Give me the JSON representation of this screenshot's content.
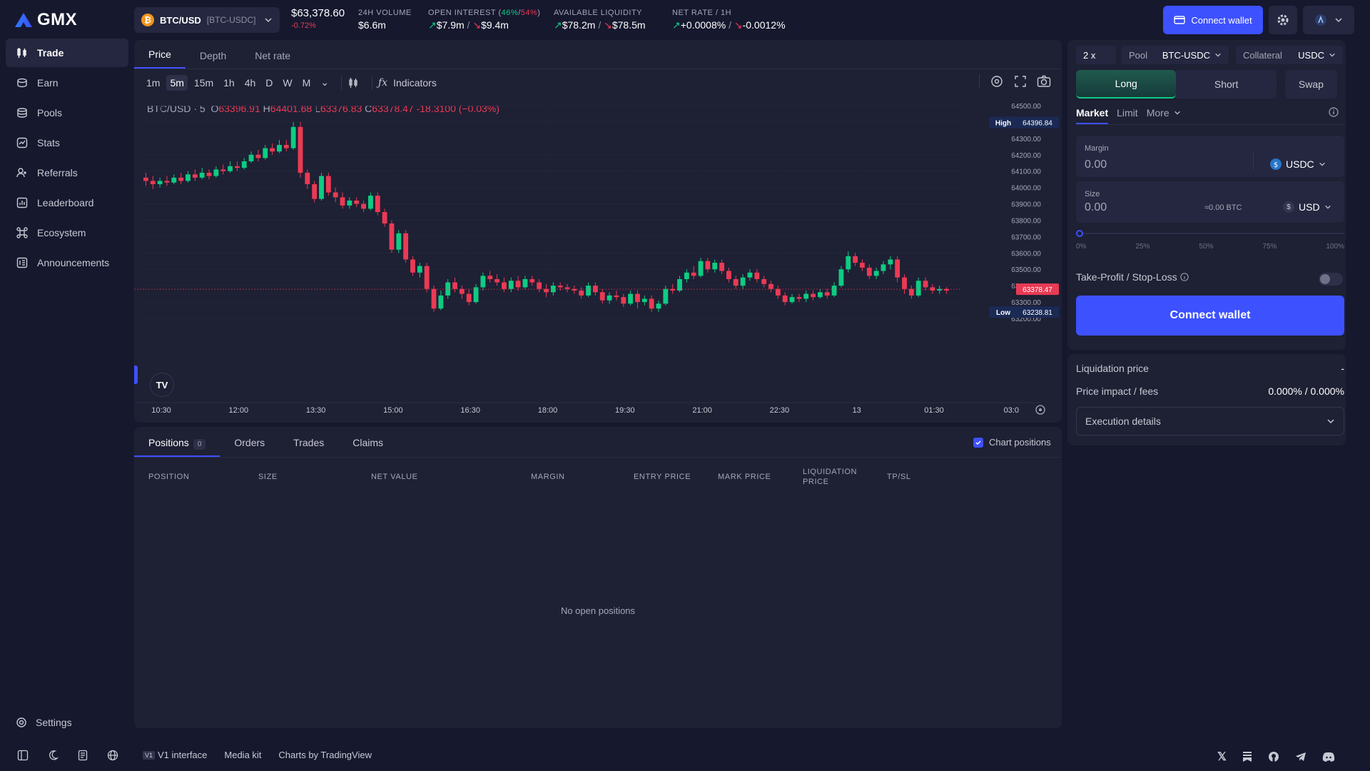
{
  "app": {
    "logo_text": "GMX"
  },
  "sidebar": {
    "items": [
      {
        "label": "Trade",
        "icon": "trade-icon",
        "active": true
      },
      {
        "label": "Earn",
        "icon": "earn-icon"
      },
      {
        "label": "Pools",
        "icon": "pools-icon"
      },
      {
        "label": "Stats",
        "icon": "stats-icon"
      },
      {
        "label": "Referrals",
        "icon": "referrals-icon"
      },
      {
        "label": "Leaderboard",
        "icon": "leaderboard-icon"
      },
      {
        "label": "Ecosystem",
        "icon": "ecosystem-icon"
      },
      {
        "label": "Announcements",
        "icon": "announcements-icon"
      }
    ],
    "settings_label": "Settings"
  },
  "header": {
    "pair": "BTC/USD",
    "pair_market": "[BTC-USDC]",
    "price": "$63,378.60",
    "price_change": "-0.72%",
    "volume_label": "24H VOLUME",
    "volume_value": "$6.6m",
    "oi_label": "OPEN INTEREST",
    "oi_long_pct": "46%",
    "oi_short_pct": "54%",
    "oi_long": "$7.9m",
    "oi_short": "$9.4m",
    "liq_label": "AVAILABLE LIQUIDITY",
    "liq_long": "$78.2m",
    "liq_short": "$78.5m",
    "rate_label": "NET RATE / 1H",
    "rate_long": "+0.0008%",
    "rate_short": "-0.0012%",
    "connect_label": "Connect wallet"
  },
  "chart": {
    "tabs": [
      "Price",
      "Depth",
      "Net rate"
    ],
    "timeframes": [
      "1m",
      "5m",
      "15m",
      "1h",
      "4h",
      "D",
      "W",
      "M"
    ],
    "active_timeframe": "5m",
    "indicators_label": "Indicators",
    "symbol_label": "BTC/USD · 5",
    "open": "63396.91",
    "high": "64401.68",
    "low": "63376.83",
    "close": "63378.47",
    "change": "-18.3100 (−0.03%)",
    "ohlc_prefix": {
      "o": "O",
      "h": "H",
      "l": "L",
      "c": "C"
    },
    "y_ticks": [
      "64500.00",
      "64400.00",
      "64300.00",
      "64200.00",
      "64100.00",
      "64000.00",
      "63900.00",
      "63800.00",
      "63700.00",
      "63600.00",
      "63500.00",
      "63400.00",
      "63300.00",
      "63200.00"
    ],
    "x_ticks": [
      "10:30",
      "12:00",
      "13:30",
      "15:00",
      "16:30",
      "18:00",
      "19:30",
      "21:00",
      "22:30",
      "13",
      "01:30",
      "03:0"
    ],
    "high_label": "High",
    "high_value": "64396.84",
    "low_label": "Low",
    "low_value": "63238.81",
    "last_value": "63378.47",
    "tv_logo": "TV"
  },
  "chart_data": {
    "type": "candlestick",
    "title": "BTC/USD · 5",
    "ylim": [
      63200,
      64500
    ],
    "y_ticks": [
      64500,
      64400,
      64300,
      64200,
      64100,
      64000,
      63900,
      63800,
      63700,
      63600,
      63500,
      63400,
      63300,
      63200
    ],
    "x_ticks": [
      "10:30",
      "12:00",
      "13:30",
      "15:00",
      "16:30",
      "18:00",
      "19:30",
      "21:00",
      "22:30",
      "13",
      "01:30",
      "03:0"
    ],
    "candles": [
      [
        64060,
        64040,
        64090,
        64010
      ],
      [
        64040,
        64020,
        64070,
        63990
      ],
      [
        64020,
        64040,
        64060,
        64000
      ],
      [
        64040,
        64030,
        64070,
        64010
      ],
      [
        64030,
        64060,
        64080,
        64020
      ],
      [
        64060,
        64040,
        64090,
        64020
      ],
      [
        64040,
        64080,
        64100,
        64030
      ],
      [
        64080,
        64060,
        64110,
        64040
      ],
      [
        64060,
        64090,
        64120,
        64050
      ],
      [
        64090,
        64070,
        64110,
        64050
      ],
      [
        64070,
        64110,
        64130,
        64060
      ],
      [
        64110,
        64100,
        64140,
        64080
      ],
      [
        64100,
        64130,
        64160,
        64090
      ],
      [
        64130,
        64120,
        64160,
        64100
      ],
      [
        64120,
        64160,
        64180,
        64110
      ],
      [
        64160,
        64200,
        64220,
        64150
      ],
      [
        64200,
        64180,
        64230,
        64160
      ],
      [
        64180,
        64240,
        64260,
        64170
      ],
      [
        64240,
        64220,
        64270,
        64200
      ],
      [
        64220,
        64260,
        64290,
        64210
      ],
      [
        64260,
        64240,
        64290,
        64220
      ],
      [
        64240,
        64370,
        64400,
        64230
      ],
      [
        64370,
        64090,
        64400,
        64060
      ],
      [
        64090,
        64020,
        64110,
        63990
      ],
      [
        64020,
        63930,
        64040,
        63910
      ],
      [
        63930,
        64070,
        64090,
        63920
      ],
      [
        64070,
        63970,
        64090,
        63950
      ],
      [
        63970,
        63940,
        64000,
        63910
      ],
      [
        63940,
        63890,
        63970,
        63870
      ],
      [
        63890,
        63920,
        63940,
        63870
      ],
      [
        63920,
        63900,
        63940,
        63880
      ],
      [
        63900,
        63870,
        63920,
        63850
      ],
      [
        63870,
        63950,
        63970,
        63860
      ],
      [
        63950,
        63850,
        63970,
        63830
      ],
      [
        63850,
        63780,
        63870,
        63760
      ],
      [
        63780,
        63620,
        63800,
        63600
      ],
      [
        63620,
        63720,
        63740,
        63600
      ],
      [
        63720,
        63560,
        63740,
        63540
      ],
      [
        63560,
        63480,
        63580,
        63460
      ],
      [
        63480,
        63520,
        63540,
        63450
      ],
      [
        63520,
        63380,
        63540,
        63360
      ],
      [
        63380,
        63260,
        63400,
        63240
      ],
      [
        63260,
        63340,
        63370,
        63250
      ],
      [
        63340,
        63420,
        63440,
        63320
      ],
      [
        63420,
        63380,
        63450,
        63360
      ],
      [
        63380,
        63350,
        63400,
        63320
      ],
      [
        63350,
        63300,
        63380,
        63280
      ],
      [
        63300,
        63390,
        63410,
        63290
      ],
      [
        63390,
        63460,
        63480,
        63370
      ],
      [
        63460,
        63440,
        63490,
        63420
      ],
      [
        63440,
        63420,
        63470,
        63400
      ],
      [
        63420,
        63380,
        63450,
        63360
      ],
      [
        63380,
        63430,
        63450,
        63360
      ],
      [
        63430,
        63390,
        63460,
        63370
      ],
      [
        63390,
        63440,
        63460,
        63380
      ],
      [
        63440,
        63420,
        63460,
        63400
      ],
      [
        63420,
        63380,
        63440,
        63360
      ],
      [
        63380,
        63360,
        63410,
        63330
      ],
      [
        63360,
        63400,
        63420,
        63340
      ],
      [
        63400,
        63390,
        63420,
        63370
      ],
      [
        63390,
        63380,
        63410,
        63360
      ],
      [
        63380,
        63370,
        63400,
        63350
      ],
      [
        63370,
        63340,
        63390,
        63320
      ],
      [
        63340,
        63400,
        63420,
        63330
      ],
      [
        63400,
        63360,
        63420,
        63340
      ],
      [
        63360,
        63310,
        63380,
        63290
      ],
      [
        63310,
        63340,
        63360,
        63290
      ],
      [
        63340,
        63330,
        63370,
        63310
      ],
      [
        63330,
        63290,
        63350,
        63270
      ],
      [
        63290,
        63350,
        63370,
        63280
      ],
      [
        63350,
        63300,
        63370,
        63260
      ],
      [
        63300,
        63320,
        63340,
        63280
      ],
      [
        63320,
        63260,
        63340,
        63240
      ],
      [
        63260,
        63290,
        63310,
        63240
      ],
      [
        63290,
        63380,
        63400,
        63280
      ],
      [
        63380,
        63370,
        63410,
        63350
      ],
      [
        63370,
        63440,
        63460,
        63360
      ],
      [
        63440,
        63480,
        63500,
        63420
      ],
      [
        63480,
        63460,
        63520,
        63440
      ],
      [
        63460,
        63550,
        63570,
        63450
      ],
      [
        63550,
        63500,
        63570,
        63480
      ],
      [
        63500,
        63540,
        63560,
        63480
      ],
      [
        63540,
        63490,
        63560,
        63470
      ],
      [
        63490,
        63440,
        63510,
        63420
      ],
      [
        63440,
        63400,
        63460,
        63380
      ],
      [
        63400,
        63450,
        63470,
        63380
      ],
      [
        63450,
        63480,
        63500,
        63430
      ],
      [
        63480,
        63440,
        63500,
        63420
      ],
      [
        63440,
        63410,
        63460,
        63390
      ],
      [
        63410,
        63380,
        63430,
        63360
      ],
      [
        63380,
        63340,
        63400,
        63320
      ],
      [
        63340,
        63300,
        63360,
        63280
      ],
      [
        63300,
        63330,
        63350,
        63290
      ],
      [
        63330,
        63320,
        63350,
        63300
      ],
      [
        63320,
        63350,
        63370,
        63300
      ],
      [
        63350,
        63330,
        63370,
        63310
      ],
      [
        63330,
        63360,
        63380,
        63320
      ],
      [
        63360,
        63340,
        63380,
        63320
      ],
      [
        63340,
        63400,
        63420,
        63330
      ],
      [
        63400,
        63500,
        63520,
        63390
      ],
      [
        63500,
        63580,
        63610,
        63480
      ],
      [
        63580,
        63540,
        63600,
        63520
      ],
      [
        63540,
        63510,
        63560,
        63490
      ],
      [
        63510,
        63460,
        63530,
        63440
      ],
      [
        63460,
        63490,
        63510,
        63440
      ],
      [
        63490,
        63530,
        63550,
        63470
      ],
      [
        63530,
        63560,
        63580,
        63500
      ],
      [
        63560,
        63450,
        63580,
        63420
      ],
      [
        63450,
        63380,
        63470,
        63350
      ],
      [
        63380,
        63340,
        63400,
        63320
      ],
      [
        63340,
        63430,
        63450,
        63330
      ],
      [
        63430,
        63390,
        63450,
        63370
      ],
      [
        63390,
        63370,
        63410,
        63350
      ],
      [
        63370,
        63380,
        63400,
        63350
      ],
      [
        63380,
        63370,
        63390,
        63350
      ]
    ],
    "candle_fields": [
      "open",
      "close",
      "high",
      "low"
    ],
    "high_marker": 64396.84,
    "low_marker": 63238.81,
    "last_price": 63378.47
  },
  "positions": {
    "tabs": [
      {
        "label": "Positions",
        "count": "0"
      },
      {
        "label": "Orders"
      },
      {
        "label": "Trades"
      },
      {
        "label": "Claims"
      }
    ],
    "chart_positions_label": "Chart positions",
    "columns": [
      "POSITION",
      "SIZE",
      "NET VALUE",
      "MARGIN",
      "ENTRY PRICE",
      "MARK PRICE",
      "LIQUIDATION PRICE",
      "TP/SL"
    ],
    "empty_text": "No open positions"
  },
  "trade": {
    "leverage": "2 x",
    "pool_label": "Pool",
    "pool_value": "BTC-USDC",
    "collateral_label": "Collateral",
    "collateral_value": "USDC",
    "sides": [
      "Long",
      "Short",
      "Swap"
    ],
    "order_types": [
      "Market",
      "Limit",
      "More"
    ],
    "margin_label": "Margin",
    "margin_value": "0.00",
    "margin_token": "USDC",
    "size_label": "Size",
    "size_value": "0.00",
    "size_btc": "≈0.00 BTC",
    "size_token": "USD",
    "slider_marks": [
      "0%",
      "25%",
      "50%",
      "75%",
      "100%"
    ],
    "tpsl_label": "Take-Profit / Stop-Loss",
    "connect_label": "Connect wallet",
    "liq_label": "Liquidation price",
    "liq_value": "-",
    "impact_label": "Price impact / fees",
    "impact_value": "0.000% / 0.000%",
    "exec_label": "Execution details"
  },
  "footer": {
    "links": [
      "V1 interface",
      "Media kit",
      "Charts by TradingView"
    ],
    "v1_badge": "V1"
  },
  "colors": {
    "accent": "#3d51ff",
    "up": "#0ecc83",
    "down": "#ea3a54",
    "bg": "#16182e",
    "panel": "#1e2034"
  }
}
